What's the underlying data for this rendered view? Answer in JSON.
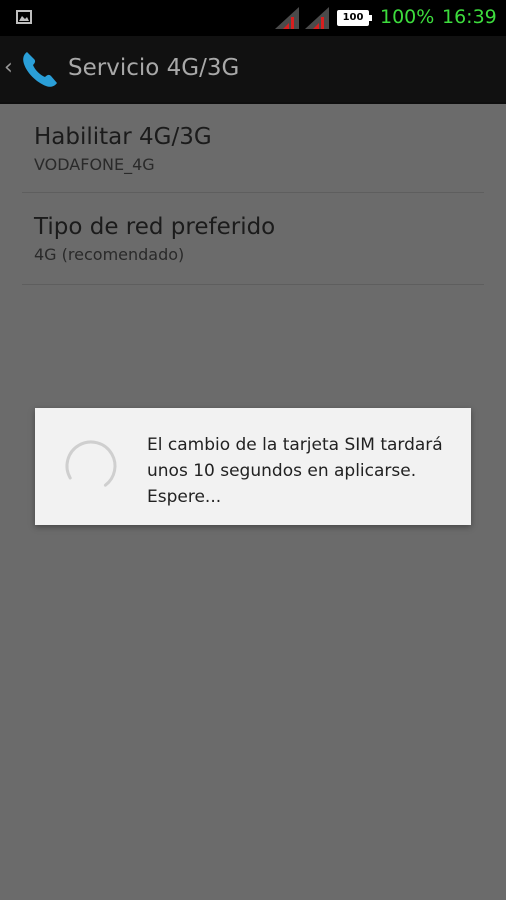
{
  "status_bar": {
    "battery_level": "100",
    "battery_percent": "100%",
    "time": "16:39",
    "icons": [
      "gallery-icon",
      "signal-icon",
      "signal-icon",
      "battery-icon"
    ],
    "colors": {
      "clock": "#3ddc3d",
      "background": "#000000"
    }
  },
  "action_bar": {
    "back": "‹",
    "title": "Servicio 4G/3G",
    "icon": "phone-icon",
    "colors": {
      "icon": "#2a9fd8",
      "background": "#111111"
    }
  },
  "preferences": [
    {
      "title": "Habilitar 4G/3G",
      "summary": "VODAFONE_4G"
    },
    {
      "title": "Tipo de red preferido",
      "summary": "4G (recomendado)"
    }
  ],
  "dialog": {
    "message": "El cambio de la tarjeta SIM tardará unos 10 segundos en aplicarse. Espere...",
    "icon": "spinner-icon"
  }
}
